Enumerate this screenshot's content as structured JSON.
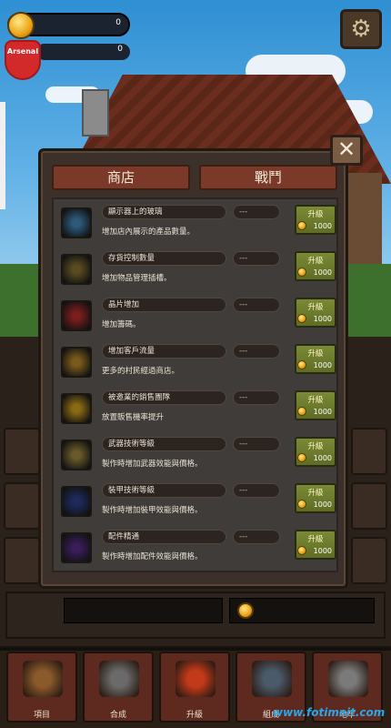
{
  "hud": {
    "coins_value": "0",
    "badge_label": "Arsenal",
    "badge_value": "0",
    "settings_icon": "gear-icon"
  },
  "popup": {
    "close_icon": "close-icon",
    "tabs": [
      {
        "label": "商店"
      },
      {
        "label": "戰鬥"
      }
    ],
    "upgrades": [
      {
        "icon": "bubbles-icon",
        "name": "顯示器上的玻璃",
        "level": "---",
        "desc": "增加店內展示的產品數量。",
        "button": "升級",
        "cost": "1000",
        "color": "#2d5a7a"
      },
      {
        "icon": "bag-icon",
        "name": "存貨控制數量",
        "level": "---",
        "desc": "增加物品管理插槽。",
        "button": "升級",
        "cost": "1000",
        "color": "#5a4a1f"
      },
      {
        "icon": "heart-icon",
        "name": "晶片增加",
        "level": "---",
        "desc": "增加籌碼。",
        "button": "升級",
        "cost": "1000",
        "color": "#7a1d1d"
      },
      {
        "icon": "crowd-icon",
        "name": "增加客戶流量",
        "level": "---",
        "desc": "更多的村民經過商店。",
        "button": "升級",
        "cost": "1000",
        "color": "#7a5a1a"
      },
      {
        "icon": "spark-icon",
        "name": "被邀業的銷售團隊",
        "level": "---",
        "desc": "放置販售機率提升",
        "button": "升級",
        "cost": "1000",
        "color": "#8a6a12"
      },
      {
        "icon": "sword-icon",
        "name": "武器技術等級",
        "level": "---",
        "desc": "製作時增加武器效能與價格。",
        "button": "升級",
        "cost": "1000",
        "color": "#6a5a2a"
      },
      {
        "icon": "shield-icon",
        "name": "裝甲技術等級",
        "level": "---",
        "desc": "製作時增加裝甲效能與價格。",
        "button": "升級",
        "cost": "1000",
        "color": "#1d2a5a"
      },
      {
        "icon": "accessory-icon",
        "name": "配件精通",
        "level": "---",
        "desc": "製作時增加配件效能與價格。",
        "button": "升級",
        "cost": "1000",
        "color": "#3a1d5a"
      }
    ]
  },
  "bottom_nav": [
    {
      "label": "項目",
      "icon": "chest-icon",
      "color": "#8a5a2a"
    },
    {
      "label": "合成",
      "icon": "hammer-icon",
      "color": "#6a6a6a"
    },
    {
      "label": "升級",
      "icon": "fire-icon",
      "color": "#c23a1a"
    },
    {
      "label": "組成",
      "icon": "helmet-icon",
      "color": "#4a5a6a"
    },
    {
      "label": "地牢",
      "icon": "skull-icon",
      "color": "#7a7a7a"
    }
  ],
  "watermark": "www.fotimeit.com",
  "colors": {
    "tab_bg": "#7b3a29",
    "upgrade_button": "#6d7c2d",
    "coin": "#e8a315"
  }
}
